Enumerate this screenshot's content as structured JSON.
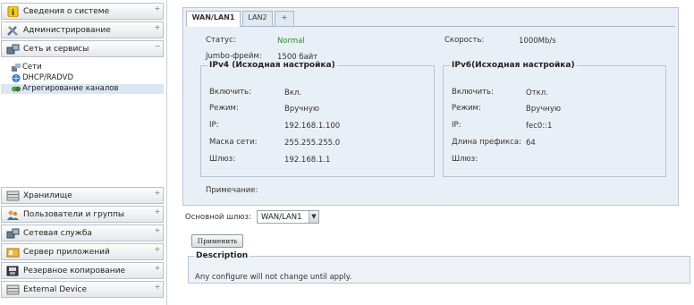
{
  "nav": {
    "sections": [
      {
        "label": "Сведения о системе",
        "icon": "info-icon",
        "state": "+"
      },
      {
        "label": "Администрирование",
        "icon": "tools-icon",
        "state": "+"
      },
      {
        "label": "Сеть и сервисы",
        "icon": "network-icon",
        "state": "−"
      },
      {
        "label": "Хранилище",
        "icon": "storage-icon",
        "state": "+"
      },
      {
        "label": "Пользователи и группы",
        "icon": "users-icon",
        "state": "+"
      },
      {
        "label": "Сетевая служба",
        "icon": "network-service-icon",
        "state": "+"
      },
      {
        "label": "Сервер приложений",
        "icon": "app-server-icon",
        "state": "+"
      },
      {
        "label": "Резервное копирование",
        "icon": "backup-icon",
        "state": "+"
      },
      {
        "label": "External Device",
        "icon": "external-device-icon",
        "state": "+"
      }
    ],
    "sub_items": [
      {
        "label": "Сети",
        "icon": "networks-icon"
      },
      {
        "label": "DHCP/RADVD",
        "icon": "dhcp-icon"
      },
      {
        "label": "Агрегирование каналов",
        "icon": "link-aggregation-icon",
        "active": true
      }
    ]
  },
  "tabs": [
    {
      "label": "WAN/LAN1",
      "active": true
    },
    {
      "label": "LAN2"
    },
    {
      "label": "+"
    }
  ],
  "general": {
    "status_label": "Статус:",
    "status_value": "Normal",
    "speed_label": "Скорость:",
    "speed_value": "1000Mb/s",
    "jumbo_label": "Jumbo-фрейм:",
    "jumbo_value": "1500 байт"
  },
  "ipv4": {
    "title": "IPv4 (Исходная настройка)",
    "enable_label": "Включить:",
    "enable_value": "Вкл.",
    "mode_label": "Режим:",
    "mode_value": "Вручную",
    "ip_label": "IP:",
    "ip_value": "192.168.1.100",
    "mask_label": "Маска сети:",
    "mask_value": "255.255.255.0",
    "gateway_label": "Шлюз:",
    "gateway_value": "192.168.1.1"
  },
  "ipv6": {
    "title": "IPv6(Исходная настройка)",
    "enable_label": "Включить:",
    "enable_value": "Откл.",
    "mode_label": "Режим:",
    "mode_value": "Вручную",
    "ip_label": "IP:",
    "ip_value": "fec0::1",
    "prefix_label": "Длина префикса:",
    "prefix_value": "64",
    "gateway_label": "Шлюз:",
    "gateway_value": ""
  },
  "note_label": "Примечание:",
  "default_gateway": {
    "label": "Основной шлюз:",
    "value": "WAN/LAN1"
  },
  "apply_label": "Применить",
  "description": {
    "title": "Description",
    "text": "Any configure will not change until apply."
  }
}
